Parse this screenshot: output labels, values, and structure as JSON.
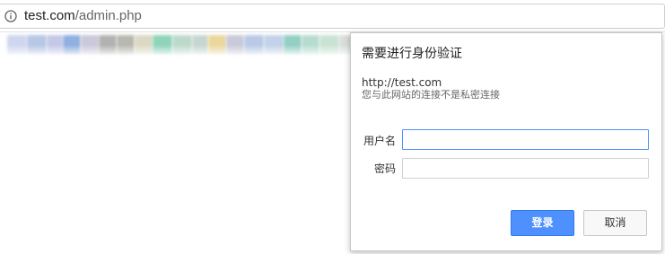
{
  "browser": {
    "url_host": "test.com",
    "url_path": "/admin.php",
    "info_icon": "info-icon"
  },
  "bookmarks": {
    "colors": [
      "#cfd6ee",
      "#b7c7e6",
      "#c4c9e7",
      "#8fb0e0",
      "#c9c9d9",
      "#b2b2b2",
      "#b8b8b0",
      "#dcd8c4",
      "#8fd4b9",
      "#bdd9cc",
      "#c6d6d0",
      "#ead79c",
      "#c9c9d9",
      "#b9c9e6",
      "#c1d2e9",
      "#93cfc2",
      "#b6dcd0",
      "#c9e3d3",
      "#d9ddd9"
    ]
  },
  "dialog": {
    "title": "需要进行身份验证",
    "host": "http://test.com",
    "warning": "您与此网站的连接不是私密连接",
    "username_label": "用户名",
    "password_label": "密码",
    "username_value": "",
    "password_value": "",
    "login_label": "登录",
    "cancel_label": "取消",
    "accent_color": "#4d90fe"
  }
}
